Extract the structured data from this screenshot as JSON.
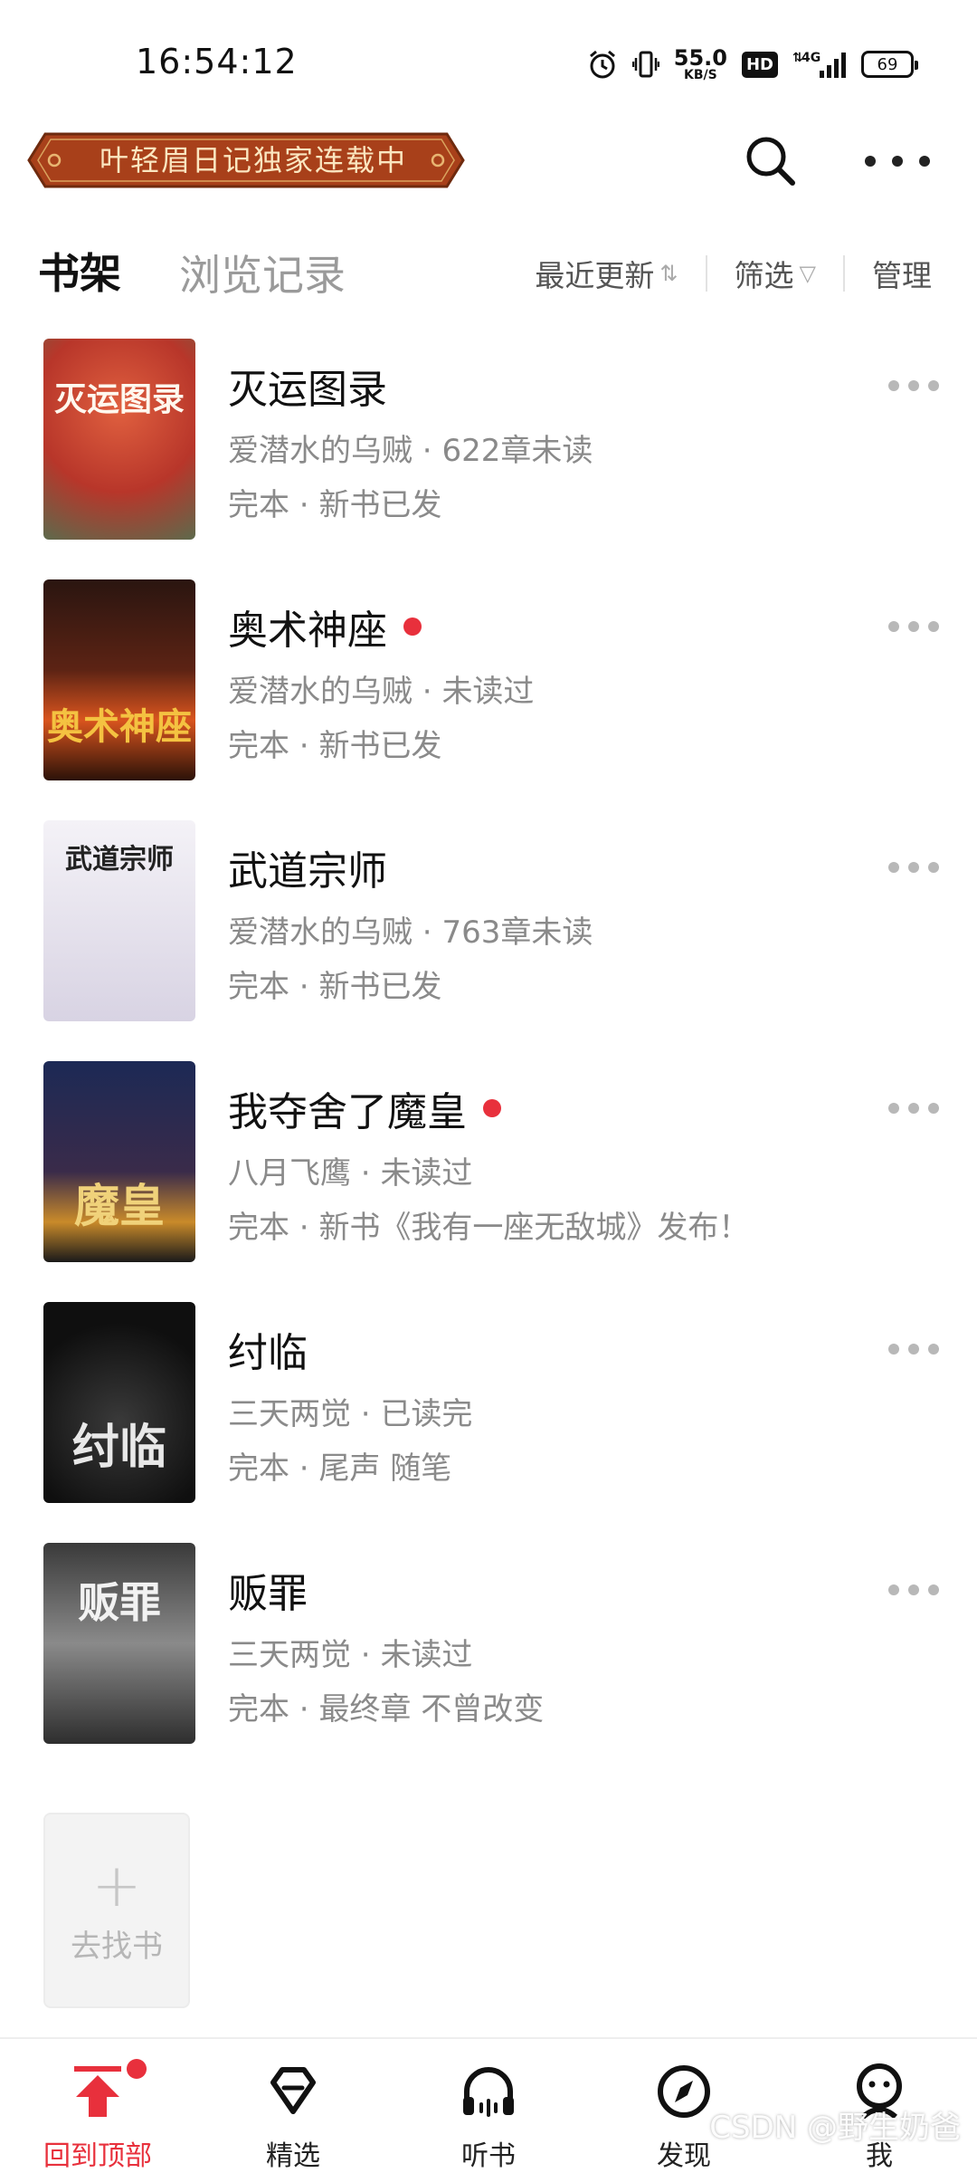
{
  "status_bar": {
    "time": "16:54:12",
    "net_speed_value": "55.0",
    "net_speed_unit": "KB/S",
    "hd_label": "HD",
    "signal_label": "4G",
    "battery": "69",
    "icons": [
      "alarm-icon",
      "vibrate-icon",
      "signal-icon"
    ]
  },
  "header": {
    "banner_text": "叶轻眉日记独家连载中",
    "search_icon": "search-icon",
    "more_icon": "more-icon"
  },
  "tabs": {
    "shelf": "书架",
    "history": "浏览记录",
    "sort_label": "最近更新",
    "sort_icon": "⇅",
    "filter_label": "筛选",
    "filter_icon": "▽",
    "manage_label": "管理"
  },
  "books": [
    {
      "title": "灭运图录",
      "author": "爱潜水的乌贼",
      "progress": "622章未读",
      "status": "完本",
      "note": "新书已发",
      "has_update": false,
      "cover_text": "灭运图录",
      "cover_color": "#c9442f"
    },
    {
      "title": "奥术神座",
      "author": "爱潜水的乌贼",
      "progress": "未读过",
      "status": "完本",
      "note": "新书已发",
      "has_update": true,
      "cover_text": "奥术神座",
      "cover_color": "#3a1d17"
    },
    {
      "title": "武道宗师",
      "author": "爱潜水的乌贼",
      "progress": "763章未读",
      "status": "完本",
      "note": "新书已发",
      "has_update": false,
      "cover_text": "武道宗师",
      "cover_color": "#e9e7ef"
    },
    {
      "title": "我夺舍了魔皇",
      "author": "八月飞鹰",
      "progress": "未读过",
      "status": "完本",
      "note": "新书《我有一座无敌城》发布！",
      "has_update": true,
      "cover_text": "魔皇",
      "cover_color": "#232a4a"
    },
    {
      "title": "纣临",
      "author": "三天两觉",
      "progress": "已读完",
      "status": "完本",
      "note": "尾声 随笔",
      "has_update": false,
      "cover_text": "纣临",
      "cover_color": "#151515"
    },
    {
      "title": "贩罪",
      "author": "三天两觉",
      "progress": "未读过",
      "status": "完本",
      "note": "最终章 不曾改变",
      "has_update": false,
      "cover_text": "贩罪",
      "cover_color": "#6f6f6f"
    }
  ],
  "find_book": {
    "plus": "+",
    "label": "去找书"
  },
  "bottom_nav": [
    {
      "label": "回到顶部",
      "icon": "back-to-top-icon",
      "active": true,
      "badge": true
    },
    {
      "label": "精选",
      "icon": "diamond-icon",
      "active": false,
      "badge": false
    },
    {
      "label": "听书",
      "icon": "headphones-icon",
      "active": false,
      "badge": false
    },
    {
      "label": "发现",
      "icon": "compass-icon",
      "active": false,
      "badge": false
    },
    {
      "label": "我",
      "icon": "profile-icon",
      "active": false,
      "badge": false
    }
  ],
  "watermark": "CSDN @野生奶爸",
  "colors": {
    "accent": "#e8303c",
    "banner": "#a8401a",
    "text_secondary": "#8a8a8a"
  }
}
